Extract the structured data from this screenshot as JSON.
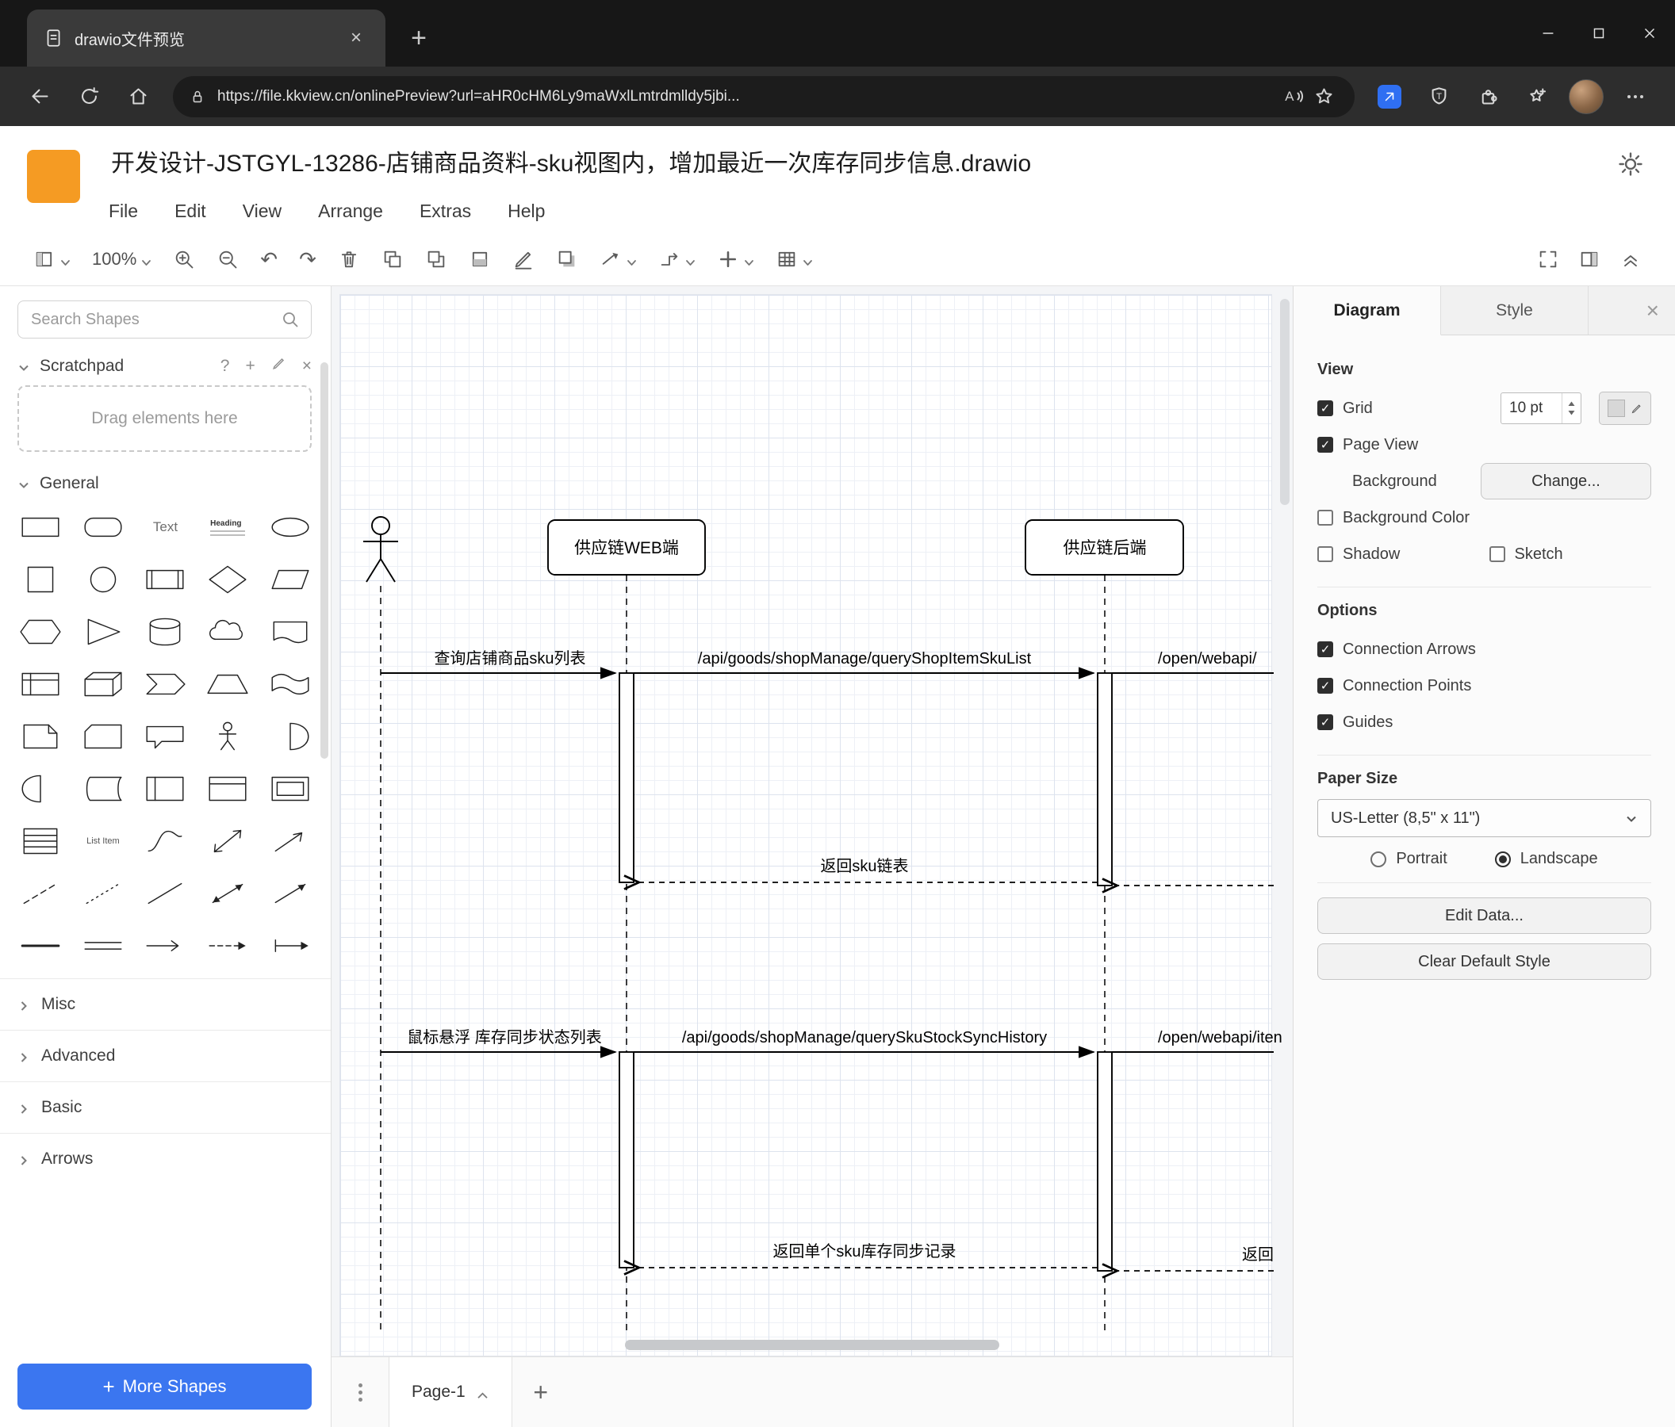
{
  "browser": {
    "tab_title": "drawio文件预览",
    "url": "https://file.kkview.cn/onlinePreview?url=aHR0cHM6Ly9maWxlLmtrdmlldy5jbi..."
  },
  "app": {
    "title": "开发设计-JSTGYL-13286-店铺商品资料-sku视图内，增加最近一次库存同步信息.drawio",
    "menus": [
      "File",
      "Edit",
      "View",
      "Arrange",
      "Extras",
      "Help"
    ],
    "zoom_level": "100%"
  },
  "sidebar": {
    "search_placeholder": "Search Shapes",
    "scratchpad_title": "Scratchpad",
    "scratchpad_hint": "Drag elements here",
    "sections": {
      "general": "General",
      "misc": "Misc",
      "advanced": "Advanced",
      "basic": "Basic",
      "arrows": "Arrows"
    },
    "shape_labels": {
      "text": "Text",
      "heading": "Heading",
      "list_item": "List Item"
    },
    "more_shapes_label": "More Shapes"
  },
  "canvas": {
    "lifeline_web": "供应链WEB端",
    "lifeline_backend": "供应链后端",
    "msg_query_sku_list": "查询店铺商品sku列表",
    "msg_api_query_shop_item_sku_list": "/api/goods/shopManage/queryShopItemSkuList",
    "msg_open_webapi_1": "/open/webapi/",
    "msg_return_sku_list": "返回sku链表",
    "msg_hover_stock_sync": "鼠标悬浮 库存同步状态列表",
    "msg_api_query_sku_stock_sync_history": "/api/goods/shopManage/querySkuStockSyncHistory",
    "msg_open_webapi_2": "/open/webapi/iten",
    "msg_return_single_sku": "返回单个sku库存同步记录",
    "msg_return_truncated": "返回",
    "page_tab": "Page-1"
  },
  "format_panel": {
    "tab_diagram": "Diagram",
    "tab_style": "Style",
    "view_heading": "View",
    "grid_label": "Grid",
    "grid_size": "10 pt",
    "page_view_label": "Page View",
    "background_label": "Background",
    "change_button": "Change...",
    "background_color_label": "Background Color",
    "shadow_label": "Shadow",
    "sketch_label": "Sketch",
    "options_heading": "Options",
    "connection_arrows_label": "Connection Arrows",
    "connection_points_label": "Connection Points",
    "guides_label": "Guides",
    "paper_size_heading": "Paper Size",
    "paper_size_value": "US-Letter (8,5\" x 11\")",
    "portrait_label": "Portrait",
    "landscape_label": "Landscape",
    "edit_data_button": "Edit Data...",
    "clear_default_style_button": "Clear Default Style"
  },
  "colors": {
    "brand_orange": "#f59b23",
    "primary_button_blue": "#3b76f0"
  }
}
